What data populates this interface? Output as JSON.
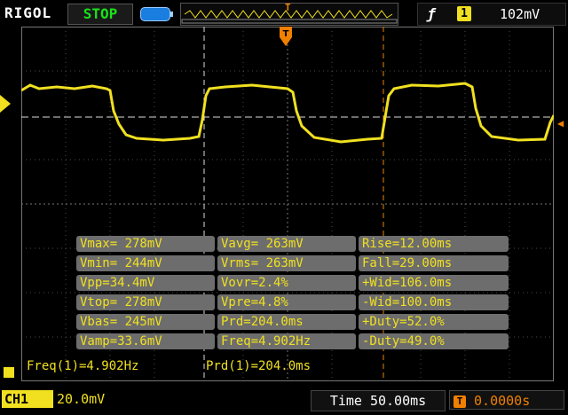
{
  "header": {
    "brand": "RIGOL",
    "run_status": "STOP",
    "trigger_source_badge": "1",
    "trigger_level": "102mV",
    "trigger_marker": "T"
  },
  "measurements": {
    "rows": [
      [
        "Vmax= 278mV",
        "Vavg= 263mV",
        "Rise=12.00ms"
      ],
      [
        "Vmin= 244mV",
        "Vrms= 263mV",
        "Fall=29.00ms"
      ],
      [
        "Vpp=34.4mV",
        "Vovr=2.4%",
        "+Wid=106.0ms"
      ],
      [
        "Vtop= 278mV",
        "Vpre=4.8%",
        "-Wid=100.0ms"
      ],
      [
        "Vbas= 245mV",
        "Prd=204.0ms",
        "+Duty=52.0%"
      ],
      [
        "Vamp=33.6mV",
        "Freq=4.902Hz",
        "-Duty=49.0%"
      ]
    ]
  },
  "counters": {
    "freq": "Freq(1)=4.902Hz",
    "prd": "Prd(1)=204.0ms"
  },
  "footer": {
    "channel": "CH1",
    "channel_scale": "20.0mV",
    "timebase": "Time 50.00ms",
    "trigger_delay": "0.0000s"
  },
  "colors": {
    "channel1": "#f0e020",
    "trigger": "#f08000",
    "status_stop": "#19e219",
    "grid": "#4a4a4a"
  },
  "icons": [
    "memory-depth-icon",
    "rising-edge-trigger-icon",
    "trigger-position-icon"
  ]
}
